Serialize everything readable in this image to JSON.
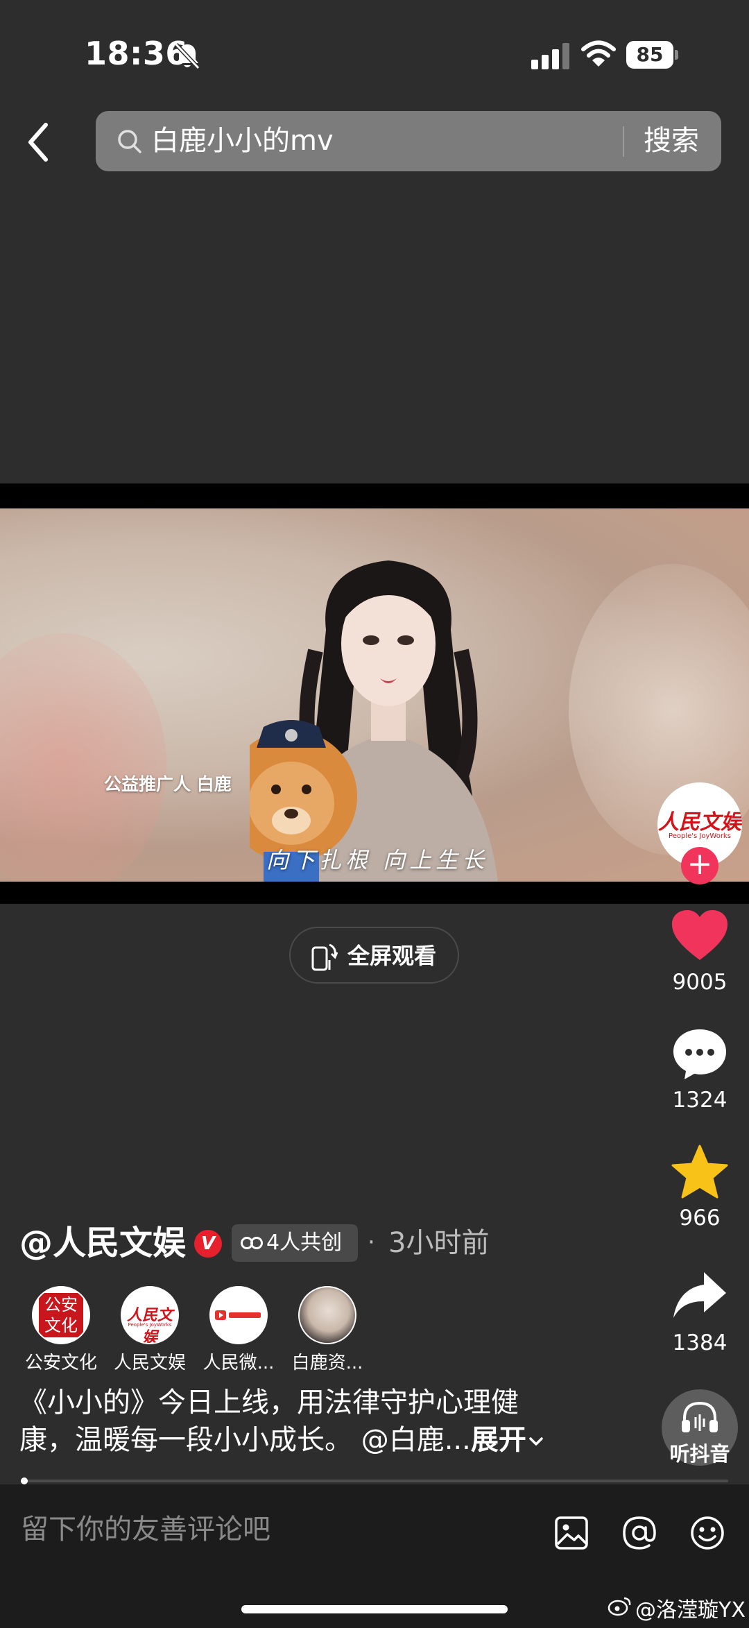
{
  "status_bar": {
    "time": "18:36",
    "battery": "85"
  },
  "search": {
    "query": "白鹿小小的mv",
    "submit_label": "搜索"
  },
  "video": {
    "promoter_caption": "公益推广人 白鹿",
    "subtitle": "向下扎根 向上生长",
    "fullscreen_label": "全屏观看"
  },
  "rail": {
    "likes": "9005",
    "comments": "1324",
    "favorites": "966",
    "shares": "1384",
    "listen_label": "听抖音",
    "avatar_logo": "人民文娱",
    "avatar_logo_sub": "People's JoyWorks"
  },
  "author": {
    "name": "@人民文娱",
    "verified_mark": "V",
    "cocreate_label": "4人共创",
    "separator": "·",
    "time_ago": "3小时前"
  },
  "creators": [
    {
      "name": "公安文化",
      "avatar": "seal"
    },
    {
      "name": "人民文娱",
      "avatar": "logo"
    },
    {
      "name": "人民微...",
      "avatar": "weibo-logo"
    },
    {
      "name": "白鹿资...",
      "avatar": "photo"
    }
  ],
  "creator_seal_text": "公安文化",
  "creator_logo_text": "人民文娱",
  "creator_logo_sub": "People's JoyWorks",
  "description": {
    "line1": "《小小的》今日上线，用法律守护心理健",
    "line2": "康，温暖每一段小小成长。 @白鹿...",
    "expand_label": "展开"
  },
  "progress": {
    "value": 0.01
  },
  "comment_bar": {
    "placeholder": "留下你的友善评论吧"
  },
  "watermark": "@洛滢璇YX",
  "colors": {
    "background": "#2e2d2d",
    "like": "#f0345c",
    "favorite": "#f8c218",
    "verified": "#e6212d",
    "brand_red": "#d2141a"
  }
}
